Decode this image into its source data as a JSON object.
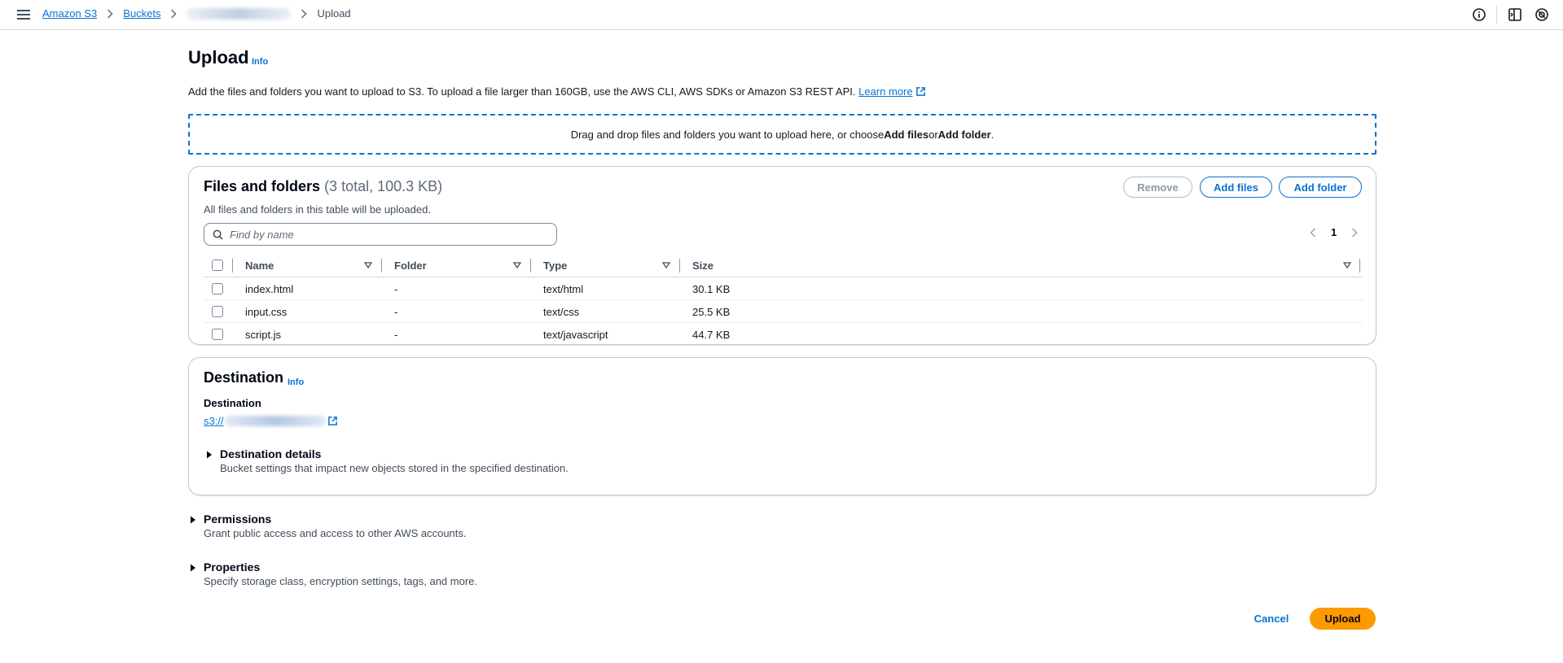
{
  "breadcrumb": {
    "items": [
      "Amazon S3",
      "Buckets"
    ],
    "current": "Upload"
  },
  "page": {
    "title": "Upload",
    "info": "Info",
    "description": "Add the files and folders you want to upload to S3. To upload a file larger than 160GB, use the AWS CLI, AWS SDKs or Amazon S3 REST API.",
    "learn_more": "Learn more"
  },
  "dropzone": {
    "prefix": "Drag and drop files and folders you want to upload here, or choose ",
    "add_files": "Add files",
    "middle": " or ",
    "add_folder": "Add folder",
    "suffix": "."
  },
  "files": {
    "title": "Files and folders",
    "count": "(3 total, 100.3 KB)",
    "description": "All files and folders in this table will be uploaded.",
    "remove_label": "Remove",
    "add_files_label": "Add files",
    "add_folder_label": "Add folder",
    "search_placeholder": "Find by name",
    "page": "1",
    "columns": [
      "Name",
      "Folder",
      "Type",
      "Size"
    ],
    "rows": [
      {
        "name": "index.html",
        "folder": "-",
        "type": "text/html",
        "size": "30.1 KB"
      },
      {
        "name": "input.css",
        "folder": "-",
        "type": "text/css",
        "size": "25.5 KB"
      },
      {
        "name": "script.js",
        "folder": "-",
        "type": "text/javascript",
        "size": "44.7 KB"
      }
    ]
  },
  "destination": {
    "title": "Destination",
    "info": "Info",
    "label": "Destination",
    "link_prefix": "s3://",
    "details_title": "Destination details",
    "details_desc": "Bucket settings that impact new objects stored in the specified destination."
  },
  "permissions": {
    "title": "Permissions",
    "desc": "Grant public access and access to other AWS accounts."
  },
  "properties": {
    "title": "Properties",
    "desc": "Specify storage class, encryption settings, tags, and more."
  },
  "footer": {
    "cancel_label": "Cancel",
    "upload_label": "Upload"
  },
  "colors": {
    "link": "#0972d3",
    "primary_button": "#ff9900",
    "border": "#c6c6cd"
  }
}
